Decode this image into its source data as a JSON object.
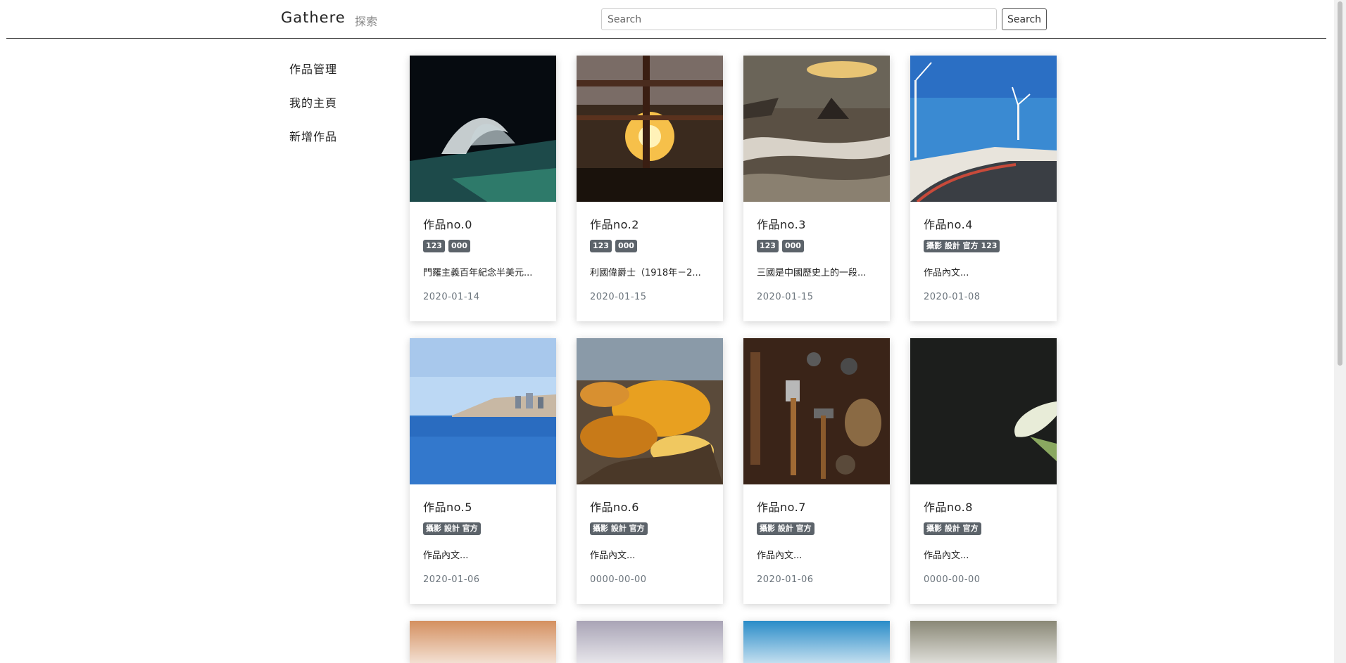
{
  "header": {
    "brand": "Gathere",
    "explore": "探索",
    "search_placeholder": "Search",
    "search_button": "Search"
  },
  "sidebar": {
    "items": [
      {
        "label": "作品管理"
      },
      {
        "label": "我的主頁"
      },
      {
        "label": "新增作品"
      }
    ]
  },
  "cards": [
    {
      "title": "作品no.0",
      "tags": [
        "123",
        "000"
      ],
      "text": "門羅主義百年紀念半美元...",
      "date": "2020-01-14"
    },
    {
      "title": "作品no.2",
      "tags": [
        "123",
        "000"
      ],
      "text": "利國偉爵士（1918年－2...",
      "date": "2020-01-15"
    },
    {
      "title": "作品no.3",
      "tags": [
        "123",
        "000"
      ],
      "text": "三國是中國歷史上的一段...",
      "date": "2020-01-15"
    },
    {
      "title": "作品no.4",
      "tags": [
        "攝影 設計 官方 123"
      ],
      "text": "作品內文...",
      "date": "2020-01-08"
    },
    {
      "title": "作品no.5",
      "tags": [
        "攝影 設計 官方"
      ],
      "text": "作品內文...",
      "date": "2020-01-06"
    },
    {
      "title": "作品no.6",
      "tags": [
        "攝影 設計 官方"
      ],
      "text": "作品內文...",
      "date": "0000-00-00"
    },
    {
      "title": "作品no.7",
      "tags": [
        "攝影 設計 官方"
      ],
      "text": "作品內文...",
      "date": "2020-01-06"
    },
    {
      "title": "作品no.8",
      "tags": [
        "攝影 設計 官方"
      ],
      "text": "作品內文...",
      "date": "0000-00-00"
    }
  ],
  "image_colors": [
    "#0c1a22",
    "#6a4a2a",
    "#7a6a58",
    "#3f8ed0",
    "#2b74c9",
    "#c9851e",
    "#4a3022",
    "#1c1e1c",
    "#d49060",
    "#a9a4b6",
    "#2a8cc8",
    "#8a8876"
  ]
}
